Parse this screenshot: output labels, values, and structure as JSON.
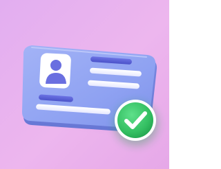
{
  "scene": {
    "background_color": "#E9B3EF",
    "card_color": "#92A6F3",
    "card_edge_color": "#7A8EE6",
    "line_color_light": "#F4F4FF",
    "line_color_dark": "#5C64D6",
    "avatar_bg_color": "#FFFFFF",
    "avatar_color": "#6A6FE0",
    "badge_color": "#3CC46B",
    "badge_ring_color": "#FFFFFF",
    "check_color": "#FFFFFF",
    "icons": [
      "id-card-icon",
      "avatar-icon",
      "checkmark-badge-icon"
    ]
  }
}
